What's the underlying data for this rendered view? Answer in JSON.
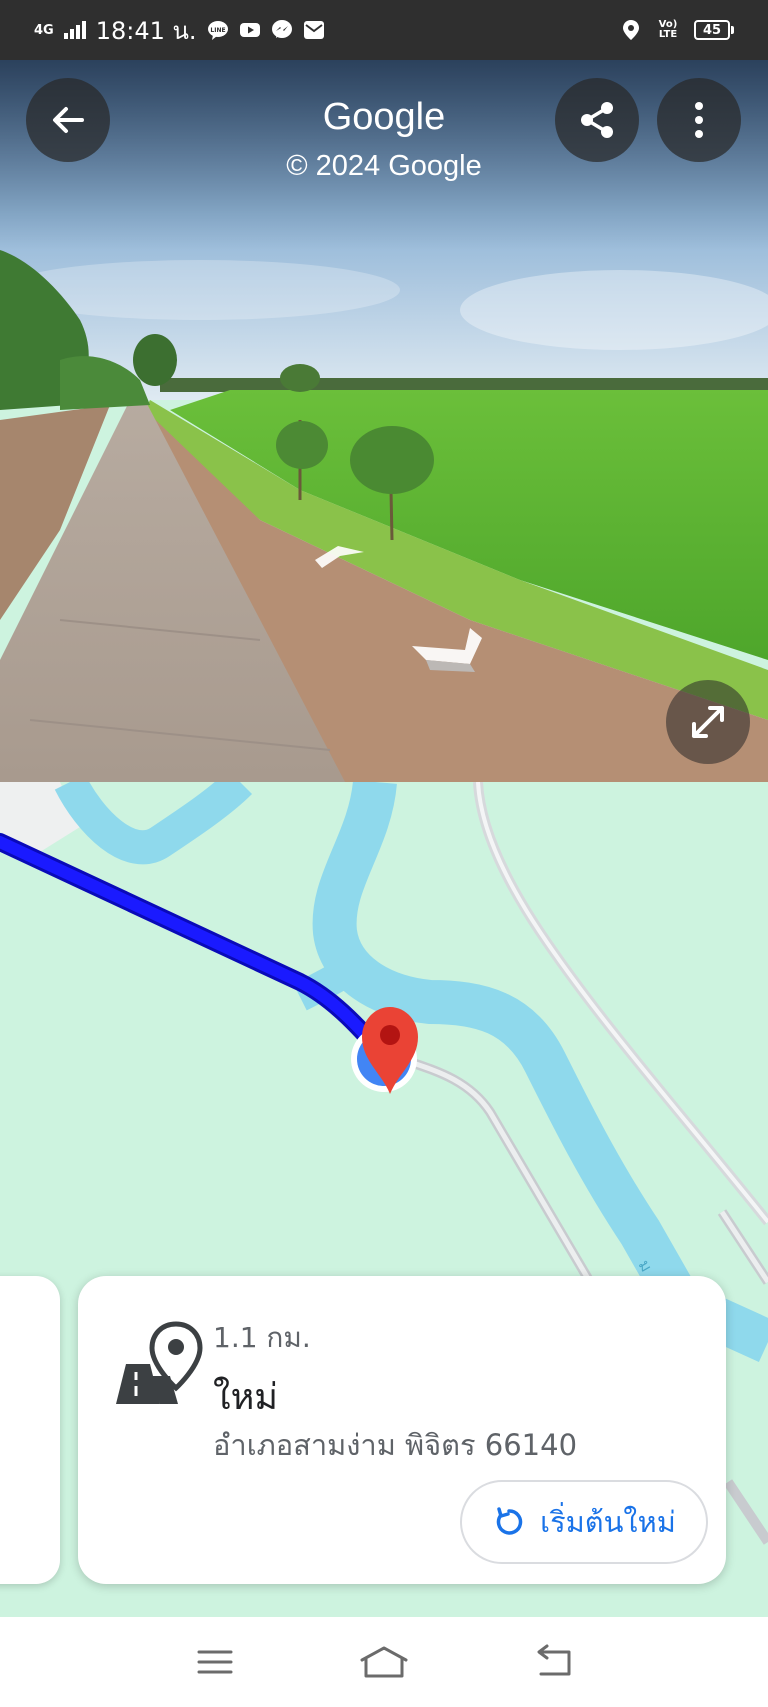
{
  "status_bar": {
    "network": "4G",
    "time": "18:41 น.",
    "volte": "Vo) LTE",
    "battery": "45"
  },
  "street_view": {
    "title": "Google",
    "copyright": "© 2024 Google"
  },
  "place": {
    "distance": "1.1 กม.",
    "name": "ใหม่",
    "address": "อำเภอสามง่าม พิจิตร 66140",
    "restart_label": "เริ่มต้นใหม่"
  },
  "colors": {
    "route": "#1a1aff",
    "pin": "#ea4335",
    "accent": "#1a73e8",
    "map_land": "#cdf3df",
    "river": "#8fd9ec"
  }
}
